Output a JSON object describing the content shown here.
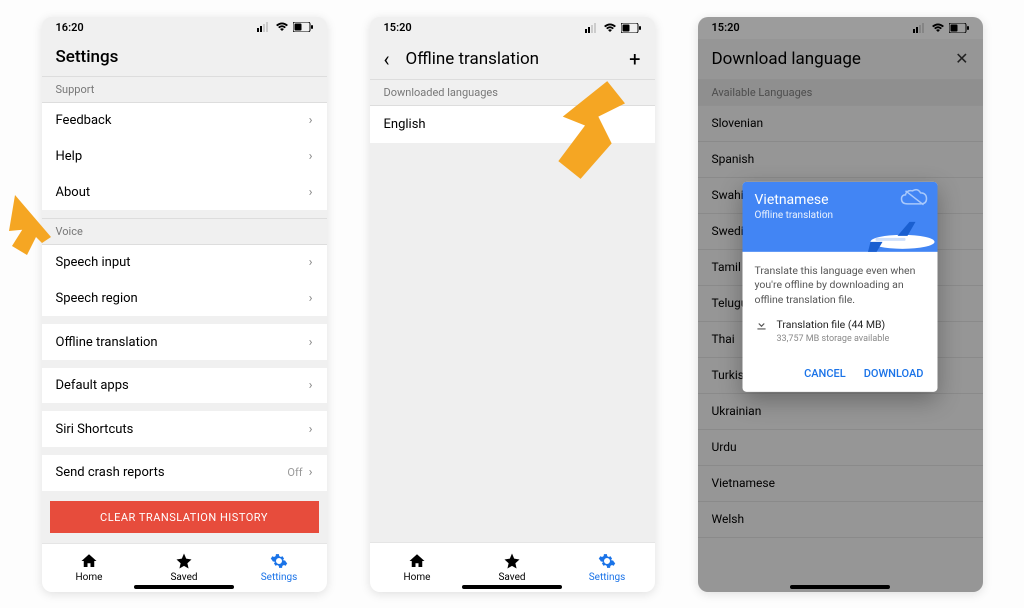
{
  "phone1": {
    "time": "16:20",
    "title": "Settings",
    "support_header": "Support",
    "feedback": "Feedback",
    "help": "Help",
    "about": "About",
    "voice_header": "Voice",
    "speech_input": "Speech input",
    "speech_region": "Speech region",
    "offline_translation": "Offline translation",
    "default_apps": "Default apps",
    "siri_shortcuts": "Siri Shortcuts",
    "send_crash": "Send crash reports",
    "off_label": "Off",
    "clear_button": "CLEAR TRANSLATION HISTORY",
    "tabs": {
      "home": "Home",
      "saved": "Saved",
      "settings": "Settings"
    }
  },
  "phone2": {
    "time": "15:20",
    "title": "Offline translation",
    "downloaded_header": "Downloaded languages",
    "english": "English",
    "tabs": {
      "home": "Home",
      "saved": "Saved",
      "settings": "Settings"
    }
  },
  "phone3": {
    "time": "15:20",
    "title": "Download language",
    "available_header": "Available Languages",
    "languages": {
      "slovenian": "Slovenian",
      "spanish": "Spanish",
      "swahili": "Swahili",
      "swedish": "Swedish",
      "tamil": "Tamil",
      "telugu": "Telugu",
      "thai": "Thai",
      "turkish": "Turkish",
      "ukrainian": "Ukrainian",
      "urdu": "Urdu",
      "vietnamese": "Vietnamese",
      "welsh": "Welsh"
    },
    "dialog": {
      "title": "Vietnamese",
      "subtitle": "Offline translation",
      "body": "Translate this language even when you're offline by downloading an offline translation file.",
      "file_label": "Translation file (44 MB)",
      "storage": "33,757 MB storage available",
      "cancel": "CANCEL",
      "download": "DOWNLOAD"
    }
  }
}
